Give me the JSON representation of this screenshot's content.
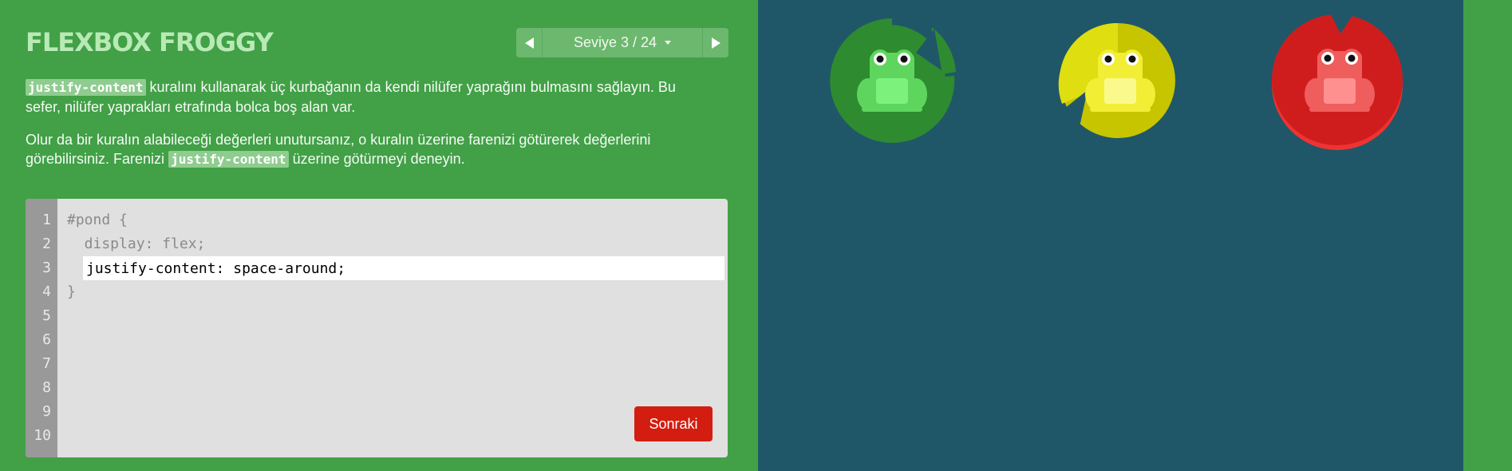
{
  "app": {
    "title": "FLEXBOX FROGGY"
  },
  "level_nav": {
    "label": "Seviye 3 / 24"
  },
  "instructions": {
    "p1": {
      "code": "justify-content",
      "text": " kuralını kullanarak üç kurbağanın da kendi nilüfer yaprağını bulmasını sağlayın. Bu sefer, nilüfer yaprakları etrafında bolca boş alan var."
    },
    "p2": {
      "text_a": "Olur da bir kuralın alabileceği değerleri unutursanız, o kuralın üzerine farenizi götürerek değerlerini görebilirsiniz. Farenizi ",
      "code": "justify-content",
      "text_b": " üzerine götürmeyi deneyin."
    }
  },
  "editor": {
    "line_numbers": [
      "1",
      "2",
      "3",
      "4",
      "5",
      "6",
      "7",
      "8",
      "9",
      "10"
    ],
    "line1": "#pond {",
    "line2": "  display: flex;",
    "answer_value": "justify-content: space-around;",
    "line4": "}",
    "next_button": "Sonraki"
  },
  "pond": {
    "frogs": [
      {
        "color": "green",
        "pad": "#2e8b2f",
        "pad_light": "#3fa03f",
        "body": "#5ed65e",
        "belly": "#7cf27c"
      },
      {
        "color": "yellow",
        "pad": "#c7c400",
        "pad_light": "#dede10",
        "body": "#f2ee36",
        "belly": "#fafa8c"
      },
      {
        "color": "red",
        "pad": "#cf1d1d",
        "pad_light": "#ee3333",
        "body": "#f05d5d",
        "belly": "#ff9090"
      }
    ]
  },
  "colors": {
    "sidebar_bg": "#42a047",
    "pond_bg": "#1f5768",
    "next_button_bg": "#d31d10"
  }
}
